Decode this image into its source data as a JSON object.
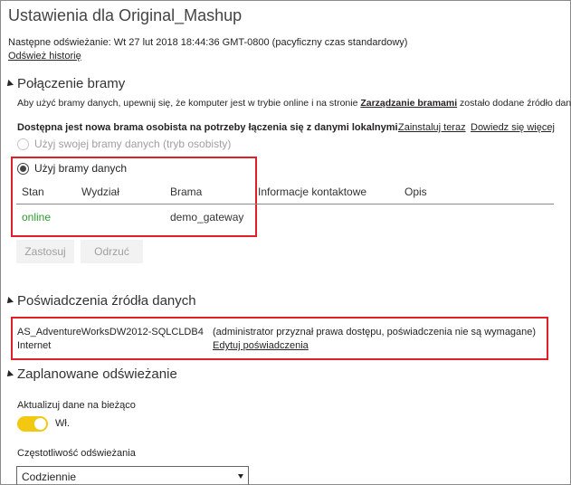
{
  "page": {
    "title": "Ustawienia dla Original_Mashup",
    "next_refresh": "Następne odświeżanie: Wt 27 lut 2018 18:44:36 GMT-0800 (pacyficzny czas standardowy)",
    "refresh_history_link": "Odśwież historię"
  },
  "gateway": {
    "section_title": "Połączenie bramy",
    "info_prefix": "Aby użyć bramy danych, upewnij się, że komputer jest w trybie online i na stronie ",
    "info_link": "Zarządzanie bramami",
    "info_suffix": " zostało dodane źródło danych.",
    "personal_notice": "Dostępna jest nowa brama osobista na potrzeby łączenia się z danymi lokalnymi.",
    "install_link": "Zainstaluj teraz",
    "learn_more_link": "Dowiedz się więcej",
    "option_personal": "Użyj swojej bramy danych (tryb osobisty)",
    "option_gateway": "Użyj bramy danych",
    "columns": [
      "Stan",
      "Wydział",
      "Brama",
      "Informacje kontaktowe",
      "Opis"
    ],
    "row": {
      "status": "online",
      "department": "",
      "gateway": "demo_gateway",
      "contact": "",
      "description": ""
    },
    "apply_button": "Zastosuj",
    "discard_button": "Odrzuć",
    "status_color": "#2e9a2e"
  },
  "credentials": {
    "section_title": "Poświadczenia źródła danych",
    "source_name": "AS_AdventureWorksDW2012-SQLCLDB4",
    "source_type": "Internet",
    "note": "(administrator przyznał prawa dostępu, poświadczenia nie są wymagane)",
    "edit_link": "Edytuj poświadczenia"
  },
  "schedule": {
    "section_title": "Zaplanowane odświeżanie",
    "keep_updated_label": "Aktualizuj dane na bieżąco",
    "toggle_state": "Wł.",
    "frequency_label": "Częstotliwość odświeżania",
    "frequency_value": "Codziennie",
    "toggle_color": "#f2c811"
  },
  "colors": {
    "highlight_border": "#e01f26"
  }
}
